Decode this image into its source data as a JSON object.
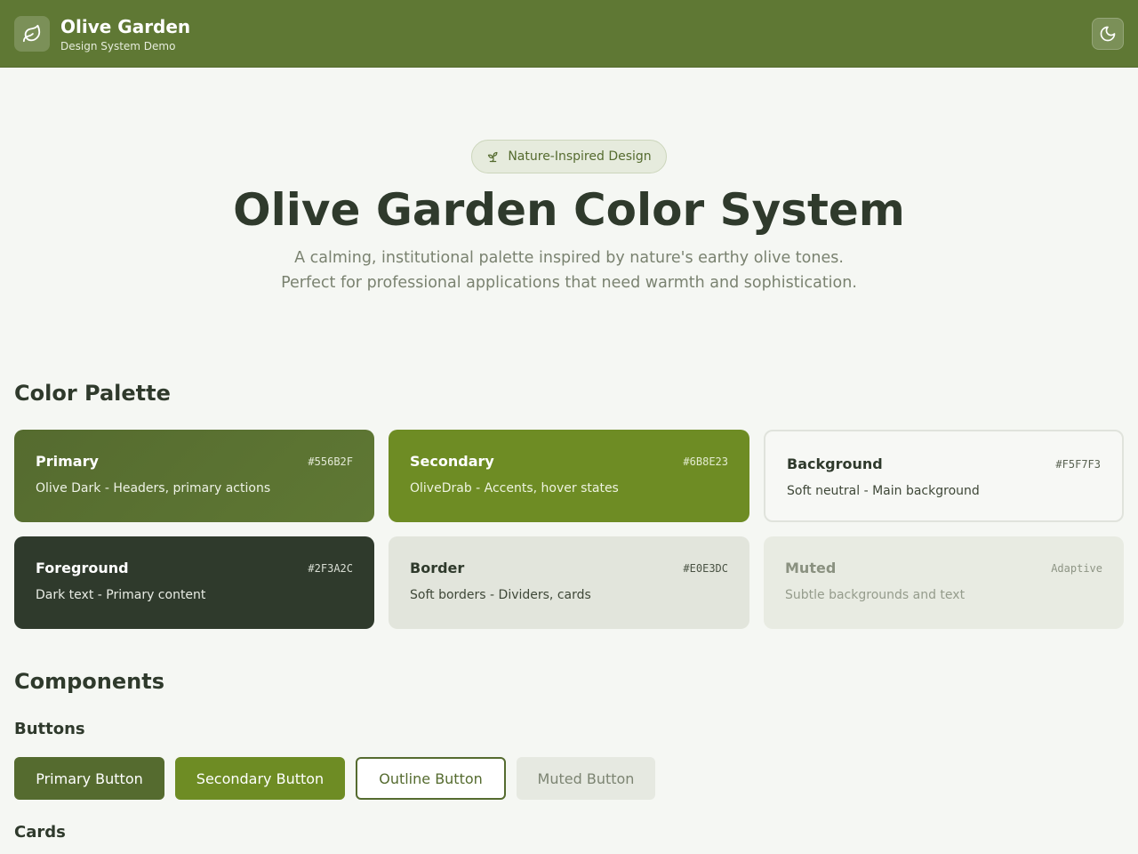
{
  "header": {
    "title": "Olive Garden",
    "subtitle": "Design System Demo",
    "logo_icon": "leaf-icon",
    "theme_icon": "moon-icon"
  },
  "hero": {
    "badge": "Nature-Inspired Design",
    "badge_icon": "sprout-icon",
    "title": "Olive Garden Color System",
    "description_line1": "A calming, institutional palette inspired by nature's earthy olive tones.",
    "description_line2": "Perfect for professional applications that need warmth and sophistication."
  },
  "palette": {
    "title": "Color Palette",
    "swatches": [
      {
        "name": "Primary",
        "hex": "#556B2F",
        "description": "Olive Dark - Headers, primary actions"
      },
      {
        "name": "Secondary",
        "hex": "#6B8E23",
        "description": "OliveDrab - Accents, hover states"
      },
      {
        "name": "Background",
        "hex": "#F5F7F3",
        "description": "Soft neutral - Main background"
      },
      {
        "name": "Foreground",
        "hex": "#2F3A2C",
        "description": "Dark text - Primary content"
      },
      {
        "name": "Border",
        "hex": "#E0E3DC",
        "description": "Soft borders - Dividers, cards"
      },
      {
        "name": "Muted",
        "hex": "Adaptive",
        "description": "Subtle backgrounds and text"
      }
    ]
  },
  "components": {
    "title": "Components",
    "buttons_title": "Buttons",
    "buttons": {
      "primary": "Primary Button",
      "secondary": "Secondary Button",
      "outline": "Outline Button",
      "muted": "Muted Button"
    },
    "cards_title": "Cards"
  },
  "colors": {
    "primary": "#556B2F",
    "secondary": "#6B8E23",
    "background": "#F5F7F3",
    "foreground": "#2F3A2C",
    "border": "#E0E3DC",
    "muted": "#E8EBE2"
  }
}
